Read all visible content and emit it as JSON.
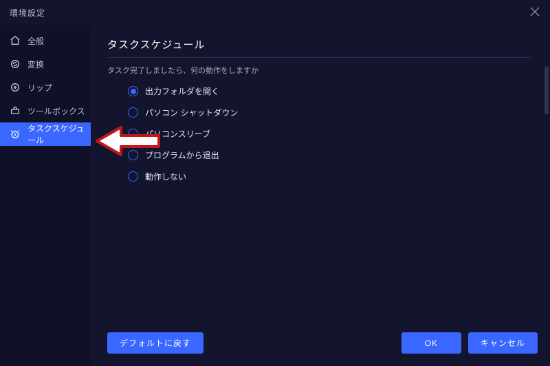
{
  "titlebar": {
    "title": "環境設定"
  },
  "sidebar": {
    "items": [
      {
        "label": "全般"
      },
      {
        "label": "変换"
      },
      {
        "label": "リップ"
      },
      {
        "label": "ツールボックス"
      },
      {
        "label": "タスクスケジュール"
      }
    ]
  },
  "section": {
    "title": "タスクスケジュール",
    "desc": "タスク完了しましたら、何の動作をしますか"
  },
  "options": [
    {
      "label": "出力フォルダを開く",
      "selected": true
    },
    {
      "label": "パソコン シャットダウン",
      "selected": false
    },
    {
      "label": "パソコンスリーブ",
      "selected": false
    },
    {
      "label": "プログラムから退出",
      "selected": false
    },
    {
      "label": "動作しない",
      "selected": false
    }
  ],
  "buttons": {
    "reset": "デフォルトに戻す",
    "ok": "OK",
    "cancel": "キャンセル"
  },
  "colors": {
    "accent": "#3a67ff"
  }
}
